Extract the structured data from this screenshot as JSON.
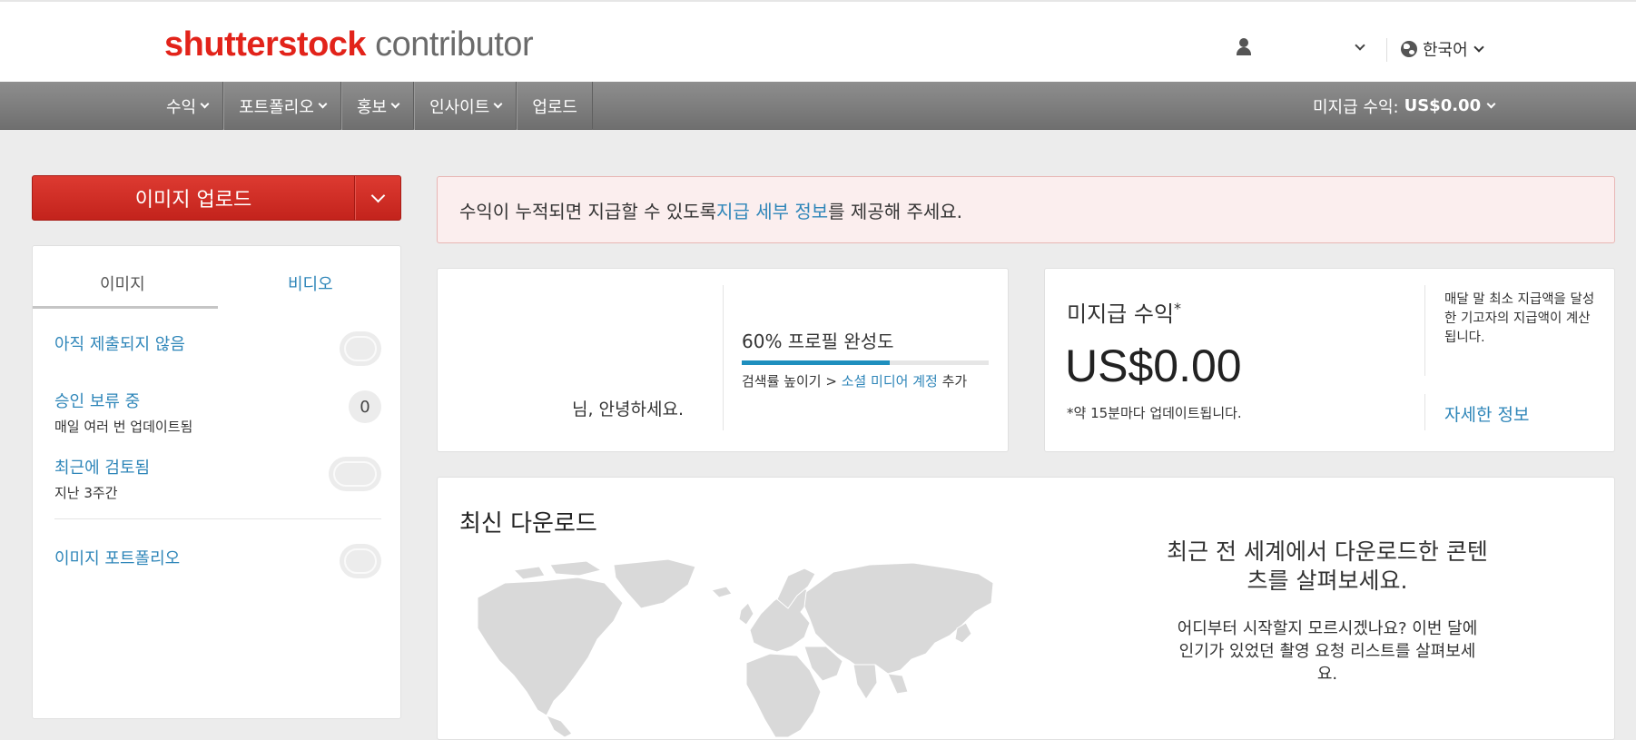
{
  "header": {
    "logo_brand": "shutterstock",
    "logo_suffix": "contributor",
    "language": "한국어"
  },
  "nav": {
    "items": [
      {
        "label": "수익",
        "has_dropdown": true
      },
      {
        "label": "포트폴리오",
        "has_dropdown": true
      },
      {
        "label": "홍보",
        "has_dropdown": true
      },
      {
        "label": "인사이트",
        "has_dropdown": true
      },
      {
        "label": "업로드",
        "has_dropdown": false
      }
    ],
    "pending_label": "미지급 수익:",
    "pending_amount": "US$0.00"
  },
  "upload_button": {
    "label": "이미지 업로드"
  },
  "sidebar": {
    "tabs": [
      {
        "label": "이미지",
        "active": true
      },
      {
        "label": "비디오",
        "active": false
      }
    ],
    "stats": [
      {
        "title": "아직 제출되지 않음",
        "subtitle": "",
        "count": ""
      },
      {
        "title": "승인 보류 중",
        "subtitle": "매일 여러 번 업데이트됨",
        "count": "0"
      },
      {
        "title": "최근에 검토됨",
        "subtitle": "지난 3주간",
        "count": ""
      },
      {
        "title": "이미지 포트폴리오",
        "subtitle": "",
        "count": ""
      }
    ]
  },
  "alert": {
    "before": "수익이 누적되면 지급할 수 있도록 ",
    "link": "지급 세부 정보",
    "after": "를 제공해 주세요."
  },
  "profile": {
    "greeting": "님, 안녕하세요.",
    "completion_label": "60% 프로필 완성도",
    "completion_percent": 60,
    "hint_before": "검색률 높이기 > ",
    "hint_link": "소셜 미디어 계정",
    "hint_after": " 추가"
  },
  "earnings": {
    "title": "미지급 수익",
    "title_mark": "*",
    "amount": "US$0.00",
    "update_note": "*약 15분마다 업데이트됩니다.",
    "side_note": "매달 말 최소 지급액을 달성한 기고자의 지급액이 계산됩니다.",
    "more_link": "자세한 정보"
  },
  "downloads": {
    "title": "최신 다운로드",
    "headline": "최근 전 세계에서 다운로드한 콘텐츠를 살펴보세요.",
    "body": "어디부터 시작할지 모르시겠나요? 이번 달에 인기가 있었던 촬영 요청 리스트를 살펴보세요."
  },
  "colors": {
    "brand_red": "#e2231a",
    "link_blue": "#2f86b9",
    "progress_blue": "#1e8fbe",
    "alert_bg": "#fbeeee"
  }
}
